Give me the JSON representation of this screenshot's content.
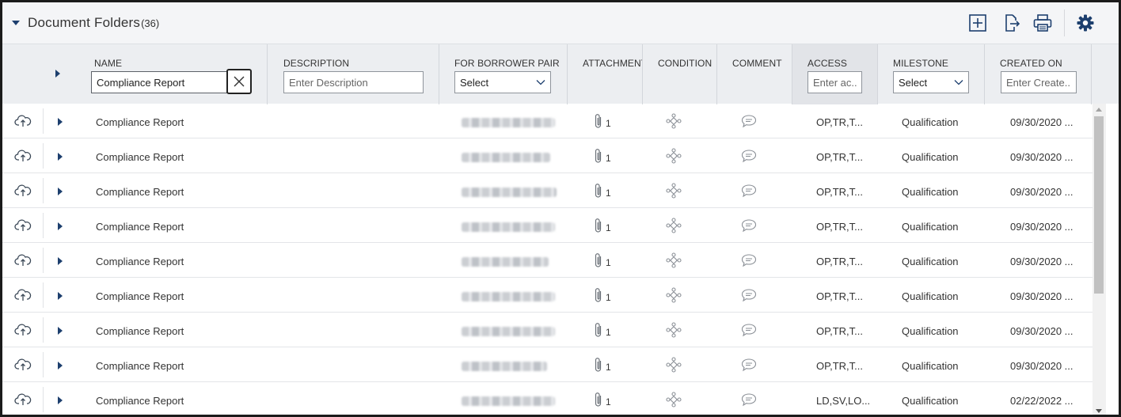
{
  "panel": {
    "title": "Document Folders",
    "count": "(36)"
  },
  "toolbar": {
    "add": "add-icon",
    "export": "export-icon",
    "print": "print-icon",
    "settings": "gear-icon"
  },
  "columns": {
    "name": {
      "label": "NAME",
      "value": "Compliance Report"
    },
    "description": {
      "label": "DESCRIPTION",
      "placeholder": "Enter Description"
    },
    "borrower": {
      "label": "FOR BORROWER PAIR",
      "selected": "Select"
    },
    "attachment": {
      "label": "ATTACHMENT"
    },
    "condition": {
      "label": "CONDITION"
    },
    "comment": {
      "label": "COMMENT"
    },
    "access": {
      "label": "ACCESS",
      "placeholder": "Enter ac..."
    },
    "milestone": {
      "label": "MILESTONE",
      "selected": "Select"
    },
    "created": {
      "label": "CREATED ON",
      "placeholder": "Enter Create..."
    }
  },
  "rows": [
    {
      "name": "Compliance Report",
      "attachments": "1",
      "access": "OP,TR,T...",
      "milestone": "Qualification",
      "created": "09/30/2020 ..."
    },
    {
      "name": "Compliance Report",
      "attachments": "1",
      "access": "OP,TR,T...",
      "milestone": "Qualification",
      "created": "09/30/2020 ..."
    },
    {
      "name": "Compliance Report",
      "attachments": "1",
      "access": "OP,TR,T...",
      "milestone": "Qualification",
      "created": "09/30/2020 ..."
    },
    {
      "name": "Compliance Report",
      "attachments": "1",
      "access": "OP,TR,T...",
      "milestone": "Qualification",
      "created": "09/30/2020 ..."
    },
    {
      "name": "Compliance Report",
      "attachments": "1",
      "access": "OP,TR,T...",
      "milestone": "Qualification",
      "created": "09/30/2020 ..."
    },
    {
      "name": "Compliance Report",
      "attachments": "1",
      "access": "OP,TR,T...",
      "milestone": "Qualification",
      "created": "09/30/2020 ..."
    },
    {
      "name": "Compliance Report",
      "attachments": "1",
      "access": "OP,TR,T...",
      "milestone": "Qualification",
      "created": "09/30/2020 ..."
    },
    {
      "name": "Compliance Report",
      "attachments": "1",
      "access": "OP,TR,T...",
      "milestone": "Qualification",
      "created": "09/30/2020 ..."
    },
    {
      "name": "Compliance Report",
      "attachments": "1",
      "access": "LD,SV,LO...",
      "milestone": "Qualification",
      "created": "02/22/2022 ..."
    }
  ],
  "colors": {
    "accent": "#1d3f6e",
    "header_bg": "#eceef1",
    "icon_gray": "#8a8f96"
  }
}
